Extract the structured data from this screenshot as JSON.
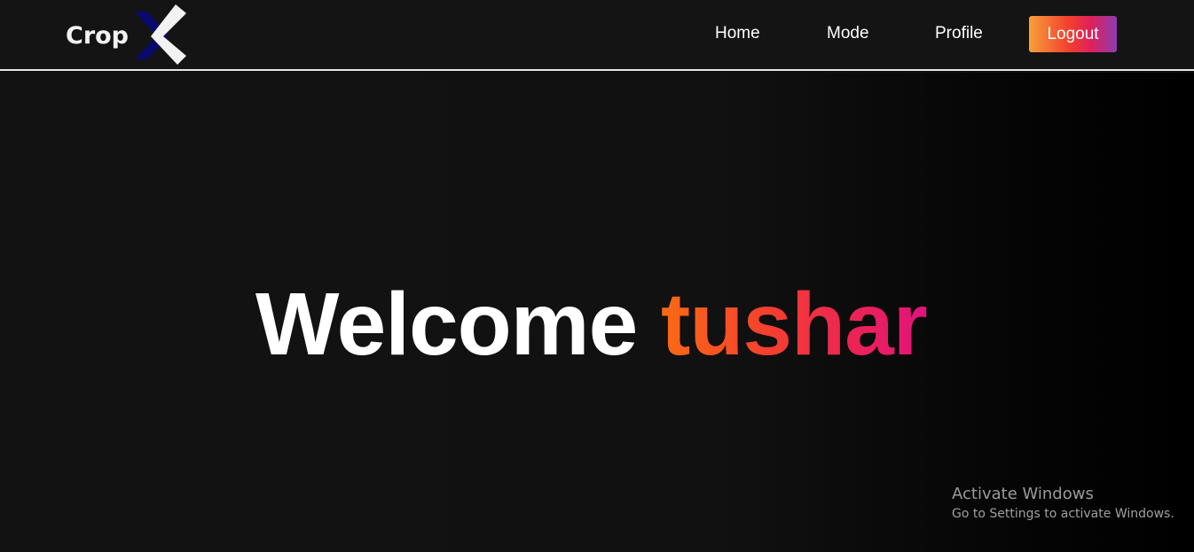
{
  "navbar": {
    "logo_text": "Crop",
    "links": {
      "home": "Home",
      "mode": "Mode",
      "profile": "Profile"
    },
    "logout_label": "Logout"
  },
  "hero": {
    "welcome": "Welcome",
    "username": "tushar"
  },
  "watermark": {
    "title": "Activate Windows",
    "subtitle": "Go to Settings to activate Windows."
  },
  "colors": {
    "background": "#101010",
    "navbar": "#141414",
    "logout_gradient": [
      "#f7a03a",
      "#f2402e",
      "#e0205a",
      "#8e3bb0"
    ],
    "username_gradient": [
      "#f86a14",
      "#f5402f",
      "#ed2553",
      "#e0137d"
    ],
    "logo_x_dark": "#0a0a6e",
    "logo_x_light": "#f2f2f2"
  },
  "icons": {
    "logo_mark": "x-logo-icon"
  }
}
